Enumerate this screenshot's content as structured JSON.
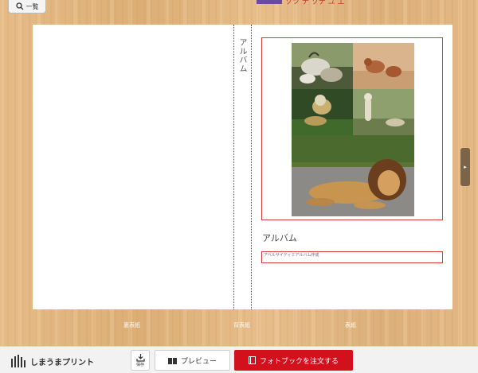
{
  "header": {
    "back_label": "一覧",
    "title_partial": "ソツ ナ ソナ ユ エ"
  },
  "spread": {
    "spine_title": "アルバム",
    "album_title": "アルバム",
    "subtitle_text": "アベルサイティミアルバム作成",
    "page_labels": [
      "裏表紙",
      "背表紙",
      "表紙"
    ]
  },
  "toolbar": {
    "brand_name": "しまうまプリント",
    "save_label": "保存",
    "preview_label": "プレビュー",
    "order_label": "フォトブックを注文する"
  },
  "colors": {
    "accent_red": "#d3111c",
    "frame_red": "#d23a3a",
    "side_tab": "#7a6548"
  },
  "icons": {
    "back": "search-icon",
    "save": "save-icon",
    "preview": "book-icon",
    "order": "photobook-icon",
    "brand": "brand-logo-icon",
    "side_tab": "chevron-right-icon"
  }
}
